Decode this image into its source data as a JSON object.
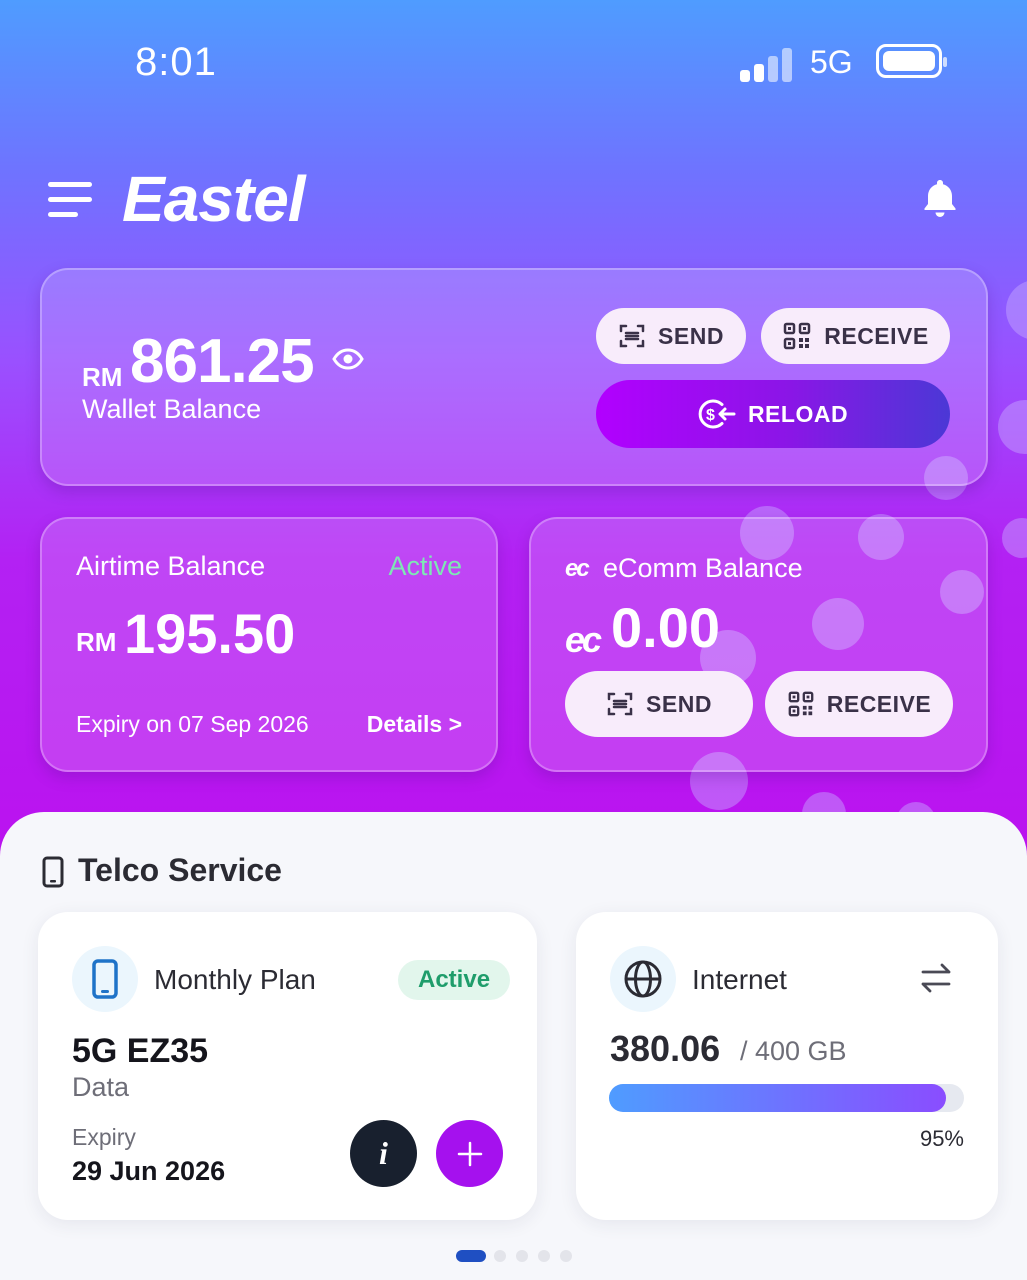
{
  "status_bar": {
    "time": "8:01",
    "network": "5G"
  },
  "header": {
    "logo": "Eastel"
  },
  "wallet": {
    "currency": "RM",
    "amount": "861.25",
    "label": "Wallet Balance",
    "send_label": "SEND",
    "receive_label": "RECEIVE",
    "reload_label": "RELOAD"
  },
  "airtime": {
    "title": "Airtime Balance",
    "status": "Active",
    "currency": "RM",
    "amount": "195.50",
    "expiry": "Expiry on 07 Sep 2026",
    "details_label": "Details >"
  },
  "ecomm": {
    "symbol": "ec",
    "title": "eComm Balance",
    "amount": "0.00",
    "send_label": "SEND",
    "receive_label": "RECEIVE"
  },
  "telco": {
    "section_title": "Telco Service",
    "plan": {
      "title": "Monthly Plan",
      "status": "Active",
      "name": "5G EZ35",
      "type": "Data",
      "expiry_label": "Expiry",
      "expiry_date": "29 Jun 2026"
    },
    "internet": {
      "title": "Internet",
      "used": "380.06",
      "total": "/ 400 GB",
      "percent_label": "95%",
      "progress": 0.95
    }
  },
  "pagination": {
    "pages": 5,
    "active": 0
  },
  "colors": {
    "accent": "#b200ff",
    "active_green": "#1f9d6b",
    "progress_start": "#4f9cff",
    "progress_end": "#8a4dff"
  }
}
